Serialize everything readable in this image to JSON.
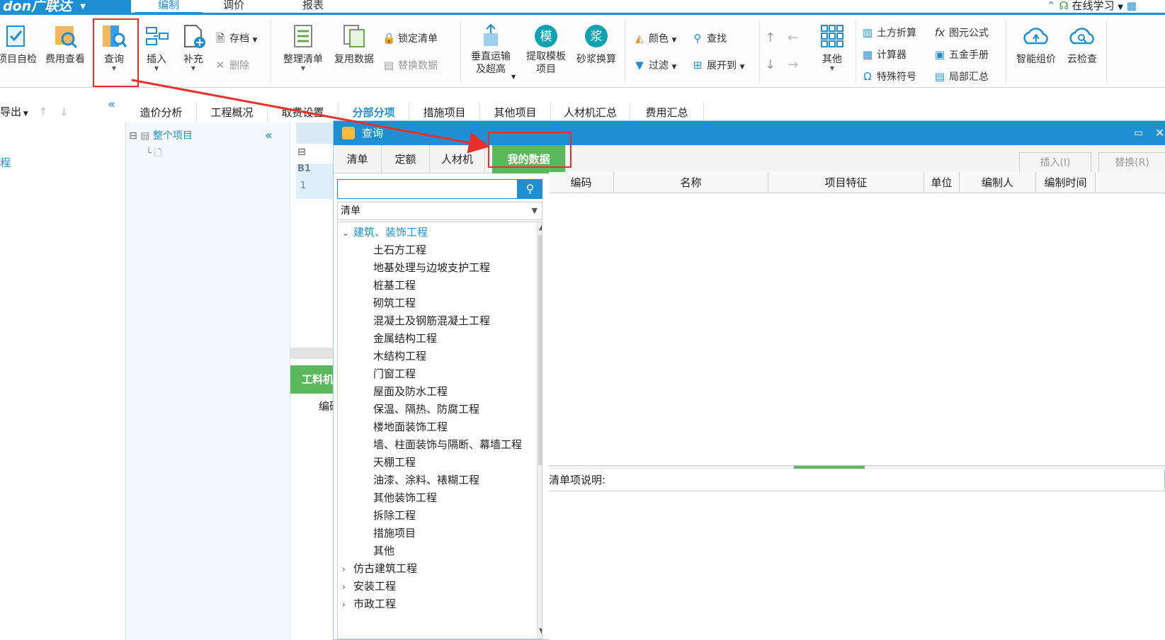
{
  "brand": {
    "name": "don广联达",
    "arrow": "▼"
  },
  "menu": {
    "tabs": [
      "编制",
      "调价",
      "报表"
    ],
    "online_learn": "在线学习"
  },
  "ribbon": {
    "project_check": "项目自检",
    "fee_view": "费用查看",
    "query": "查询",
    "insert": "插入",
    "supplement": "补充",
    "save_archive": "存档",
    "delete": "删除",
    "organize_list": "整理清单",
    "reuse_data": "复用数据",
    "lock_list": "锁定清单",
    "replace_data": "替换数据",
    "vertical_transport": "垂直运输",
    "over_height": "及超高",
    "extract_template": "提取模板",
    "extract_template_item": "项目",
    "mortar_convert": "砂浆换算",
    "color": "颜色",
    "find": "查找",
    "filter": "过滤",
    "expand_to": "展开到",
    "other": "其他",
    "earthwork_convert": "土方折算",
    "calculator": "计算器",
    "special_symbol": "特殊符号",
    "figure_formula": "图元公式",
    "hardware_manual": "五金手册",
    "partial_summary": "局部汇总",
    "smart_pricing": "智能组价",
    "cloud_check": "云检查",
    "icon_mo": "模",
    "icon_jiang": "浆"
  },
  "subbar": {
    "export": "导出",
    "tabs": [
      "造价分析",
      "工程概况",
      "取费设置",
      "分部分项",
      "措施项目",
      "其他项目",
      "人材机汇总",
      "费用汇总"
    ]
  },
  "left_panel": {
    "item": "程"
  },
  "tree_panel": {
    "whole_project": "整个项目"
  },
  "grid_strip": {
    "b1": "B1",
    "row1": "1",
    "bottom_tab": "工料机",
    "bottom_col": "编码"
  },
  "dialog": {
    "title": "查询",
    "tabs": [
      "清单",
      "定额",
      "人材机",
      "我的数据"
    ],
    "insert_btn": "插入(I)",
    "replace_btn": "替换(R)",
    "search": {
      "value": "",
      "placeholder": ""
    },
    "select_value": "清单",
    "tree": {
      "root": "建筑、装饰工程",
      "children": [
        "土石方工程",
        "地基处理与边坡支护工程",
        "桩基工程",
        "砌筑工程",
        "混凝土及钢筋混凝土工程",
        "金属结构工程",
        "木结构工程",
        "门窗工程",
        "屋面及防水工程",
        "保温、隔热、防腐工程",
        "楼地面装饰工程",
        "墙、柱面装饰与隔断、幕墙工程",
        "天棚工程",
        "油漆、涂料、裱糊工程",
        "其他装饰工程",
        "拆除工程",
        "措施项目",
        "其他"
      ],
      "siblings": [
        "仿古建筑工程",
        "安装工程",
        "市政工程"
      ]
    },
    "columns": [
      "编码",
      "名称",
      "项目特征",
      "单位",
      "编制人",
      "编制时间"
    ],
    "desc_label": "清单项说明:"
  },
  "colors": {
    "accent": "#1f8fd4",
    "active_tab": "#5cb85c",
    "highlight": "#e8302a"
  }
}
